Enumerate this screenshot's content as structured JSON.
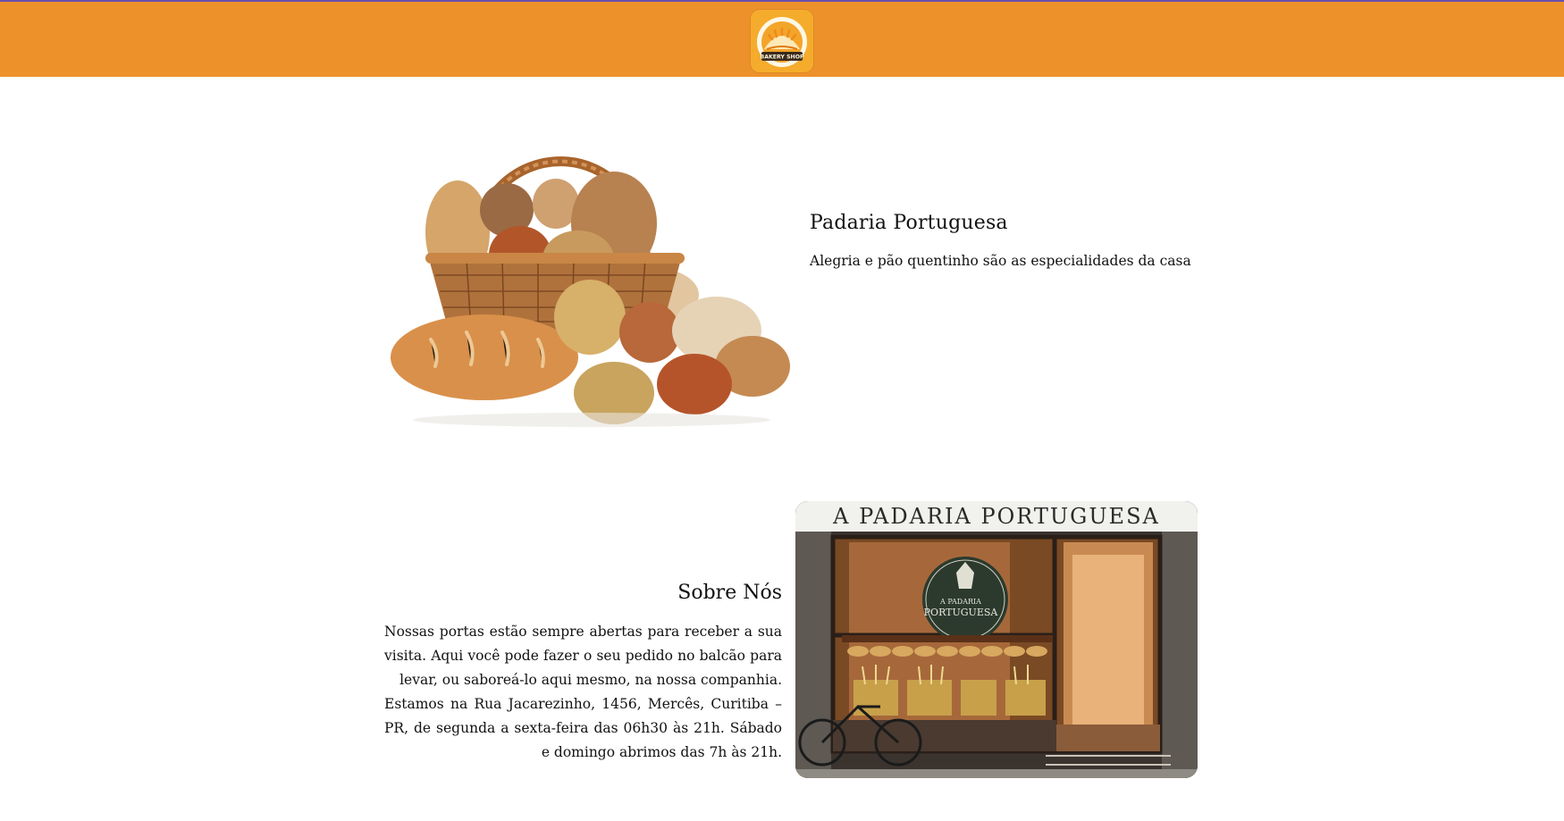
{
  "header": {
    "logo_text": "BAKERY SHOP",
    "background": "#ed912b",
    "accent_line": "#6a4fb0"
  },
  "hero": {
    "image_icon": "bread-basket-image",
    "title": "Padaria Portuguesa",
    "subtitle": "Alegria e pão quentinho são as especialidades da casa"
  },
  "about": {
    "title": "Sobre Nós",
    "paragraphs": [
      "Nossas portas estão sempre abertas para receber a sua visita. Aqui você pode fazer o seu pedido no balcão para levar, ou saboreá-lo aqui mesmo, na nossa companhia.",
      "Estamos na Rua Jacarezinho, 1456, Mercês, Curitiba – PR, de segunda a sexta-feira das 06h30 às 21h. Sábado e domingo abrimos das 7h às 21h."
    ],
    "storefront": {
      "sign_text": "A PADARIA PORTUGUESA",
      "emblem_small": "A PADARIA",
      "emblem_main": "PORTUGUESA"
    }
  }
}
